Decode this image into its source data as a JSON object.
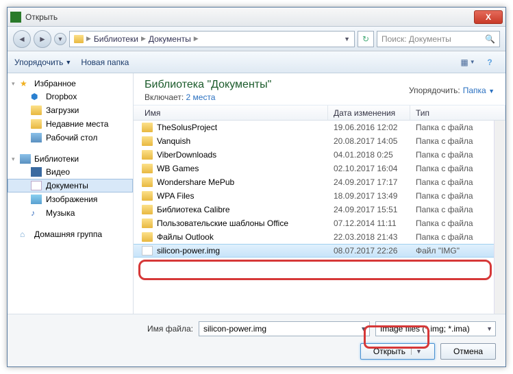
{
  "titlebar": {
    "title": "Открыть",
    "close": "X"
  },
  "nav": {
    "back": "◄",
    "fwd": "►",
    "crumbs": [
      "Библиотеки",
      "Документы"
    ],
    "refresh": "↻",
    "search_placeholder": "Поиск: Документы"
  },
  "toolbar": {
    "organize": "Упорядочить",
    "newfolder": "Новая папка",
    "view": "▦",
    "help": "?"
  },
  "sidebar": {
    "fav": {
      "label": "Избранное",
      "items": [
        "Dropbox",
        "Загрузки",
        "Недавние места",
        "Рабочий стол"
      ]
    },
    "lib": {
      "label": "Библиотеки",
      "items": [
        "Видео",
        "Документы",
        "Изображения",
        "Музыка"
      ]
    },
    "home": {
      "label": "Домашняя группа"
    }
  },
  "libheader": {
    "title": "Библиотека \"Документы\"",
    "sub_label": "Включает:",
    "sub_link": "2 места",
    "arrange_label": "Упорядочить:",
    "arrange_value": "Папка"
  },
  "columns": {
    "name": "Имя",
    "date": "Дата изменения",
    "type": "Тип"
  },
  "files": [
    {
      "name": "TheSolusProject",
      "date": "19.06.2016 12:02",
      "type": "Папка с файла",
      "kind": "folder"
    },
    {
      "name": "Vanquish",
      "date": "20.08.2017 14:05",
      "type": "Папка с файла",
      "kind": "folder"
    },
    {
      "name": "ViberDownloads",
      "date": "04.01.2018 0:25",
      "type": "Папка с файла",
      "kind": "folder"
    },
    {
      "name": "WB Games",
      "date": "02.10.2017 16:04",
      "type": "Папка с файла",
      "kind": "folder"
    },
    {
      "name": "Wondershare MePub",
      "date": "24.09.2017 17:17",
      "type": "Папка с файла",
      "kind": "folder"
    },
    {
      "name": "WPA Files",
      "date": "18.09.2017 13:49",
      "type": "Папка с файла",
      "kind": "folder"
    },
    {
      "name": "Библиотека Calibre",
      "date": "24.09.2017 15:51",
      "type": "Папка с файла",
      "kind": "folder"
    },
    {
      "name": "Пользовательские шаблоны Office",
      "date": "07.12.2014 11:11",
      "type": "Папка с файла",
      "kind": "folder"
    },
    {
      "name": "Файлы Outlook",
      "date": "22.03.2018 21:43",
      "type": "Папка с файла",
      "kind": "folder"
    },
    {
      "name": "silicon-power.img",
      "date": "08.07.2017 22:26",
      "type": "Файл \"IMG\"",
      "kind": "file",
      "selected": true
    }
  ],
  "bottom": {
    "fname_label": "Имя файла:",
    "fname_value": "silicon-power.img",
    "filter": "Image files (*.img; *.ima)",
    "open": "Открыть",
    "cancel": "Отмена"
  }
}
